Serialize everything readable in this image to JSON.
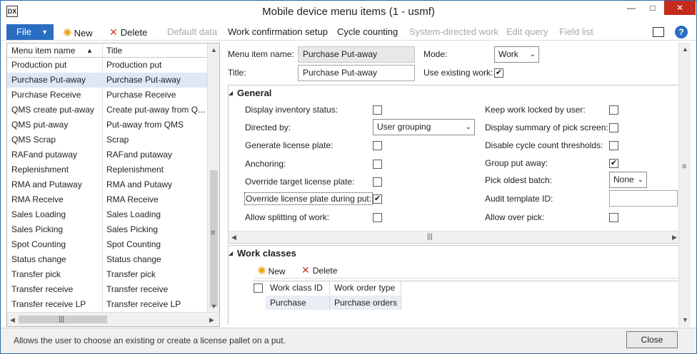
{
  "window": {
    "title": "Mobile device menu items (1 - usmf)",
    "app_icon": "DX",
    "min_glyph": "—",
    "max_glyph": "□",
    "close_glyph": "✕"
  },
  "toolbar": {
    "file_label": "File",
    "new_label": "New",
    "delete_label": "Delete",
    "default_data_label": "Default data",
    "work_confirmation_label": "Work confirmation setup",
    "cycle_counting_label": "Cycle counting",
    "system_directed_label": "System-directed work",
    "edit_query_label": "Edit query",
    "field_list_label": "Field list",
    "help_glyph": "?"
  },
  "list": {
    "col1_header": "Menu item name",
    "col2_header": "Title",
    "rows": [
      {
        "name": "Production put",
        "title": "Production put"
      },
      {
        "name": "Purchase Put-away",
        "title": "Purchase Put-away"
      },
      {
        "name": "Purchase Receive",
        "title": "Purchase Receive"
      },
      {
        "name": "QMS create put-away",
        "title": "Create put-away from Q..."
      },
      {
        "name": "QMS put-away",
        "title": "Put-away from QMS"
      },
      {
        "name": "QMS Scrap",
        "title": "Scrap"
      },
      {
        "name": "RAFand putaway",
        "title": "RAFand putaway"
      },
      {
        "name": "Replenishment",
        "title": "Replenishment"
      },
      {
        "name": "RMA and Putaway",
        "title": "RMA and Putawy"
      },
      {
        "name": "RMA Receive",
        "title": "RMA Receive"
      },
      {
        "name": "Sales Loading",
        "title": "Sales Loading"
      },
      {
        "name": "Sales Picking",
        "title": "Sales Picking"
      },
      {
        "name": "Spot Counting",
        "title": "Spot Counting"
      },
      {
        "name": "Status change",
        "title": "Status change"
      },
      {
        "name": "Transfer pick",
        "title": "Transfer pick"
      },
      {
        "name": "Transfer receive",
        "title": "Transfer receive"
      },
      {
        "name": "Transfer receive LP",
        "title": "Transfer receive LP"
      }
    ],
    "selected_index": 1
  },
  "header": {
    "menu_item_name_label": "Menu item name:",
    "menu_item_name_value": "Purchase Put-away",
    "title_label": "Title:",
    "title_value": "Purchase Put-away",
    "mode_label": "Mode:",
    "mode_value": "Work",
    "use_existing_label": "Use existing work:",
    "use_existing_checked": true
  },
  "general": {
    "title": "General",
    "display_inventory_status_label": "Display inventory status:",
    "display_inventory_status": false,
    "directed_by_label": "Directed by:",
    "directed_by_value": "User grouping",
    "generate_license_plate_label": "Generate license plate:",
    "generate_license_plate": false,
    "anchoring_label": "Anchoring:",
    "anchoring": false,
    "override_target_lp_label": "Override target license plate:",
    "override_target_lp": false,
    "override_lp_during_put_label": "Override license plate during put:",
    "override_lp_during_put": true,
    "allow_splitting_label": "Allow splitting of work:",
    "allow_splitting": false,
    "keep_work_locked_label": "Keep work locked by user:",
    "keep_work_locked": false,
    "display_summary_label": "Display summary of pick screen:",
    "display_summary": false,
    "disable_cycle_count_label": "Disable cycle count thresholds:",
    "disable_cycle_count": false,
    "group_put_away_label": "Group put away:",
    "group_put_away": true,
    "pick_oldest_batch_label": "Pick oldest batch:",
    "pick_oldest_batch_value": "None",
    "audit_template_label": "Audit template ID:",
    "audit_template_value": "",
    "allow_over_pick_label": "Allow over pick:",
    "allow_over_pick": false
  },
  "work_classes": {
    "title": "Work classes",
    "new_label": "New",
    "delete_label": "Delete",
    "col1_header": "Work class ID",
    "col2_header": "Work order type",
    "rows": [
      {
        "id": "Purchase",
        "type": "Purchase orders"
      }
    ]
  },
  "status": {
    "text": "Allows the user to choose an existing or create a license pallet on a put.",
    "close_label": "Close"
  }
}
